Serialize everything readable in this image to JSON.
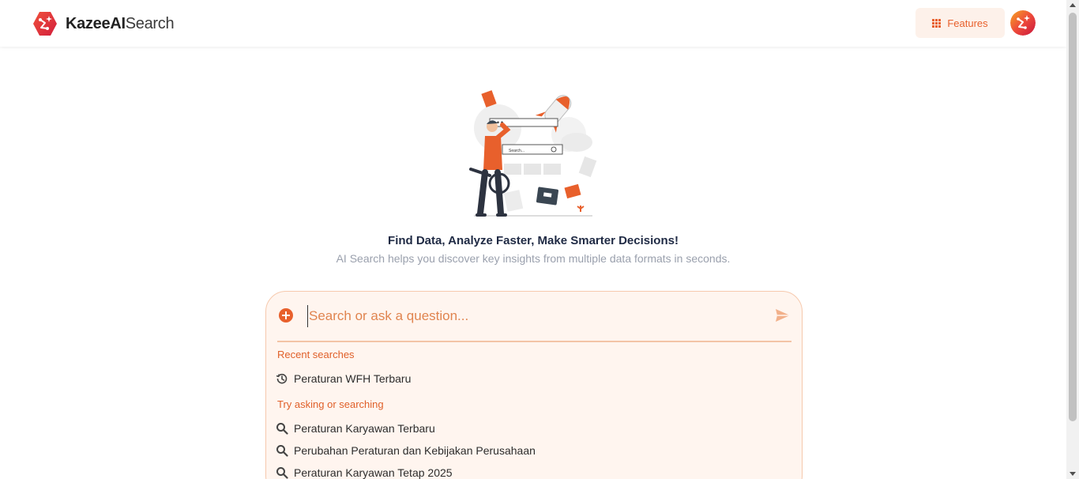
{
  "brand": {
    "name_bold": "KazeeAI",
    "name_light": "Search",
    "icon": "kazee-logo-icon"
  },
  "header": {
    "features_label": "Features",
    "features_icon": "grid-dots-icon",
    "avatar_icon": "user-avatar-icon"
  },
  "hero": {
    "headline": "Find Data, Analyze Faster, Make Smarter Decisions!",
    "subline": "AI Search helps you discover key insights from multiple data formats in seconds.",
    "illustration_search_text": "Search..."
  },
  "search": {
    "placeholder": "Search or ask a question...",
    "value": "",
    "add_icon": "plus-circle-icon",
    "send_icon": "send-icon"
  },
  "recent": {
    "label": "Recent searches",
    "items": [
      {
        "text": "Peraturan WFH Terbaru",
        "icon": "history-icon"
      }
    ]
  },
  "suggestions": {
    "label": "Try asking or searching",
    "items": [
      {
        "text": "Peraturan Karyawan Terbaru",
        "icon": "search-icon"
      },
      {
        "text": "Perubahan Peraturan dan Kebijakan Perusahaan",
        "icon": "search-icon"
      },
      {
        "text": "Peraturan Karyawan Tetap 2025",
        "icon": "search-icon"
      }
    ]
  },
  "colors": {
    "accent": "#e8602c",
    "card_bg": "#fff5ef",
    "card_border": "#f6c9ad",
    "headline": "#1f2a44",
    "muted": "#9aa0ad"
  }
}
